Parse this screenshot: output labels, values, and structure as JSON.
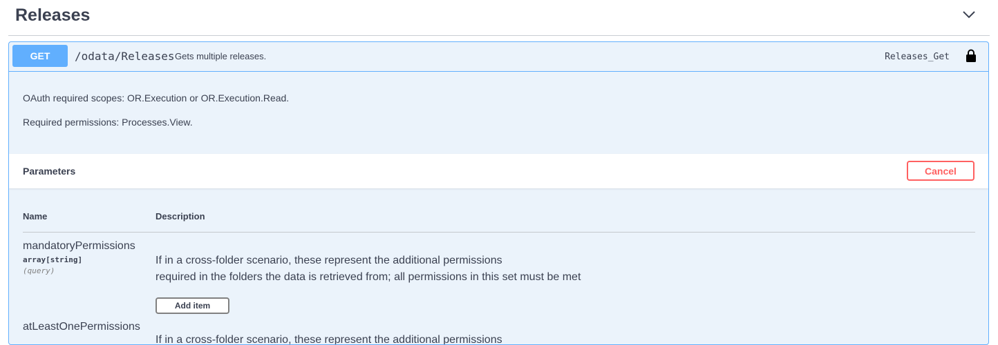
{
  "section": {
    "title": "Releases"
  },
  "operation": {
    "method": "GET",
    "path": "/odata/Releases",
    "summary": "Gets multiple releases.",
    "operation_id": "Releases_Get",
    "description_lines": [
      "OAuth required scopes: OR.Execution or OR.Execution.Read.",
      "Required permissions: Processes.View."
    ]
  },
  "parameters": {
    "title": "Parameters",
    "cancel_label": "Cancel",
    "columns": {
      "name": "Name",
      "description": "Description"
    },
    "items": [
      {
        "name": "mandatoryPermissions",
        "type": "array[string]",
        "in": "(query)",
        "description_line1": "If in a cross-folder scenario, these represent the additional permissions",
        "description_line2": "required in the folders the data is retrieved from; all permissions in this set must be met",
        "add_item_label": "Add item"
      },
      {
        "name": "atLeastOnePermissions",
        "description_line1": "If in a cross-folder scenario, these represent the additional permissions"
      }
    ]
  },
  "colors": {
    "get_method": "#61affe",
    "opblock_bg": "#ebf3fb",
    "cancel": "#ff6060",
    "text": "#3b4151"
  },
  "icons": {
    "collapse": "chevron-down-icon",
    "auth": "lock-icon"
  }
}
